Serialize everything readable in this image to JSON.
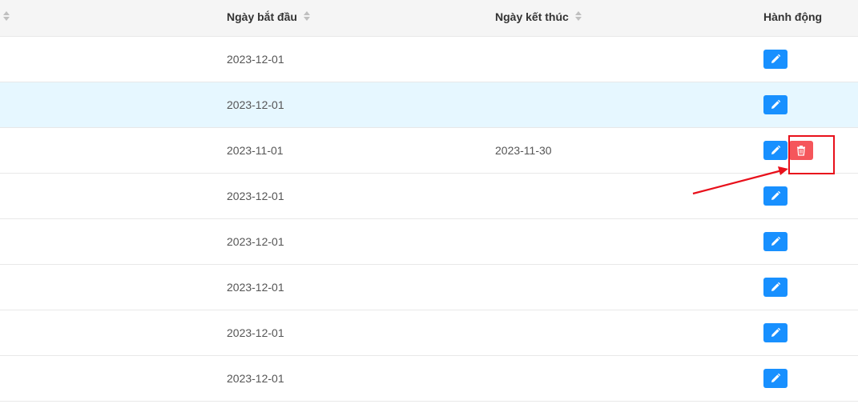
{
  "table": {
    "columns": {
      "start_date": "Ngày bắt đầu",
      "end_date": "Ngày kết thúc",
      "actions": "Hành động"
    },
    "rows": [
      {
        "start_date": "2023-12-01",
        "end_date": "",
        "highlighted": false,
        "has_delete": false
      },
      {
        "start_date": "2023-12-01",
        "end_date": "",
        "highlighted": true,
        "has_delete": false
      },
      {
        "start_date": "2023-11-01",
        "end_date": "2023-11-30",
        "highlighted": false,
        "has_delete": true
      },
      {
        "start_date": "2023-12-01",
        "end_date": "",
        "highlighted": false,
        "has_delete": false
      },
      {
        "start_date": "2023-12-01",
        "end_date": "",
        "highlighted": false,
        "has_delete": false
      },
      {
        "start_date": "2023-12-01",
        "end_date": "",
        "highlighted": false,
        "has_delete": false
      },
      {
        "start_date": "2023-12-01",
        "end_date": "",
        "highlighted": false,
        "has_delete": false
      },
      {
        "start_date": "2023-12-01",
        "end_date": "",
        "highlighted": false,
        "has_delete": false
      }
    ],
    "icons": {
      "edit": "pencil-icon",
      "delete": "trash-icon",
      "sort": "sort-icon"
    }
  },
  "colors": {
    "edit_button": "#1890ff",
    "delete_button": "#f5565b",
    "row_highlight": "#e6f7ff",
    "annotation": "#e8101b"
  }
}
